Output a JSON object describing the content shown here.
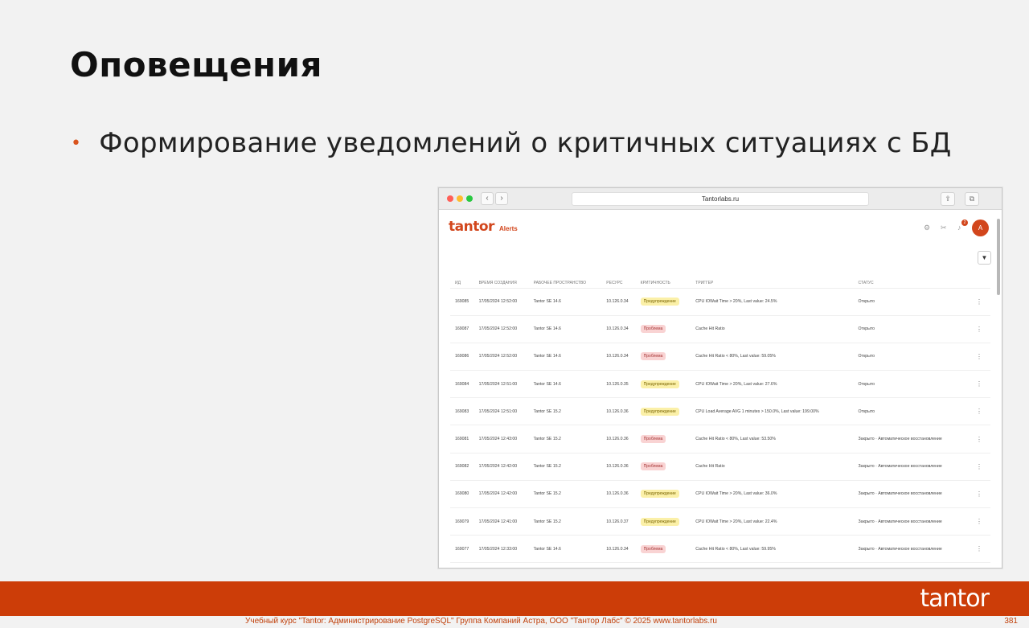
{
  "slide": {
    "title": "Оповещения",
    "bullet": "Формирование уведомлений о критичных ситуациях с БД",
    "footer_text": "Учебный курс \"Tantor: Администрирование PostgreSQL\" Группа Компаний Астра, ООО \"Тантор Лабс\" © 2025  www.tantorlabs.ru",
    "page_number": "381",
    "footer_logo": "tantor",
    "accent_color": "#cc3d08"
  },
  "browser": {
    "url": "Tantorlabs.ru",
    "back_icon": "‹",
    "forward_icon": "›",
    "share_icon": "⇪",
    "tabs_icon": "⧉"
  },
  "app": {
    "logo": "tantor",
    "nav_label": "Alerts",
    "notification_count": "2",
    "avatar_initial": "A",
    "filter_icon": "▼",
    "columns": [
      "ИД",
      "Время создания",
      "Рабочее пространство",
      "Ресурс",
      "Критичность",
      "Триггер",
      "Статус"
    ],
    "rows": [
      {
        "id": "169085",
        "time": "17/05/2024 12:52:00",
        "ws": "Tantor SE 14.6",
        "res": "10.126.0.34",
        "sev": "Предупреждение",
        "sev_type": "warn",
        "trigger": "CPU IOWait Time > 20%, Last value: 24.5%",
        "status": "Открыто"
      },
      {
        "id": "169087",
        "time": "17/05/2024 12:52:00",
        "ws": "Tantor SE 14.6",
        "res": "10.126.0.34",
        "sev": "Проблема",
        "sev_type": "err",
        "trigger": "Cache Hit Ratio",
        "status": "Открыто"
      },
      {
        "id": "169086",
        "time": "17/05/2024 12:52:00",
        "ws": "Tantor SE 14.6",
        "res": "10.126.0.34",
        "sev": "Проблема",
        "sev_type": "err",
        "trigger": "Cache Hit Ratio < 80%, Last value: 59.05%",
        "status": "Открыто"
      },
      {
        "id": "169084",
        "time": "17/05/2024 12:51:00",
        "ws": "Tantor SE 14.6",
        "res": "10.126.0.35",
        "sev": "Предупреждение",
        "sev_type": "warn",
        "trigger": "CPU IOWait Time > 20%, Last value: 27.6%",
        "status": "Открыто"
      },
      {
        "id": "169083",
        "time": "17/05/2024 12:51:00",
        "ws": "Tantor SE 15.2",
        "res": "10.126.0.36",
        "sev": "Предупреждение",
        "sev_type": "warn",
        "trigger": "CPU Load Average AVG 1 minutes > 150.0%, Last value: 199.00%",
        "status": "Открыто"
      },
      {
        "id": "169081",
        "time": "17/05/2024 12:43:00",
        "ws": "Tantor SE 15.2",
        "res": "10.126.0.36",
        "sev": "Проблема",
        "sev_type": "err",
        "trigger": "Cache Hit Ratio < 80%, Last value: 53.50%",
        "status": "Закрыто · Автоматическое восстановление"
      },
      {
        "id": "169082",
        "time": "17/05/2024 12:42:00",
        "ws": "Tantor SE 15.2",
        "res": "10.126.0.36",
        "sev": "Проблема",
        "sev_type": "err",
        "trigger": "Cache Hit Ratio",
        "status": "Закрыто · Автоматическое восстановление"
      },
      {
        "id": "169080",
        "time": "17/05/2024 12:42:00",
        "ws": "Tantor SE 15.2",
        "res": "10.126.0.36",
        "sev": "Предупреждение",
        "sev_type": "warn",
        "trigger": "CPU IOWait Time > 20%, Last value: 36.0%",
        "status": "Закрыто · Автоматическое восстановление"
      },
      {
        "id": "169079",
        "time": "17/05/2024 12:41:00",
        "ws": "Tantor SE 15.2",
        "res": "10.126.0.37",
        "sev": "Предупреждение",
        "sev_type": "warn",
        "trigger": "CPU IOWait Time > 20%, Last value: 22.4%",
        "status": "Закрыто · Автоматическое восстановление"
      },
      {
        "id": "169077",
        "time": "17/05/2024 12:33:00",
        "ws": "Tantor SE 14.6",
        "res": "10.126.0.34",
        "sev": "Проблема",
        "sev_type": "err",
        "trigger": "Cache Hit Ratio < 80%, Last value: 59.95%",
        "status": "Закрыто · Автоматическое восстановление"
      }
    ]
  }
}
